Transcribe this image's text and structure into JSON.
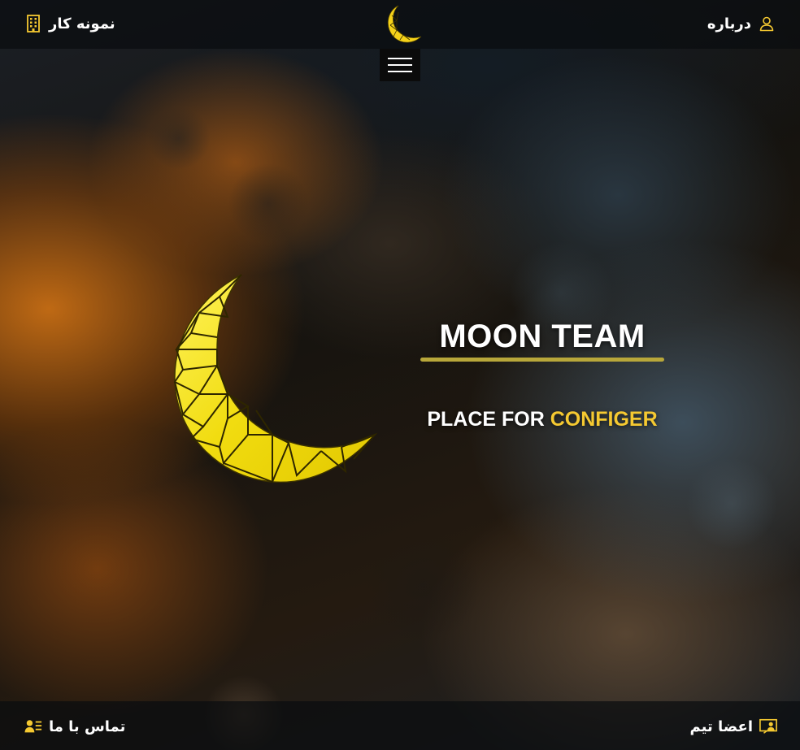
{
  "colors": {
    "accent": "#f5c931",
    "underline": "#b8a73a",
    "bar_background": "#0a0c0f",
    "text": "#ffffff"
  },
  "header": {
    "about": {
      "label": "درباره",
      "icon": "user-icon"
    },
    "portfolio": {
      "label": "نمونه کار",
      "icon": "building-icon"
    },
    "logo_icon": "crescent-moon-logo",
    "menu_icon": "hamburger-menu-icon"
  },
  "hero": {
    "title": "MOON TEAM",
    "subtitle_prefix": "PLACE FOR",
    "subtitle_highlight": "CONFIGER",
    "moon_icon": "crescent-moon-logo"
  },
  "footer": {
    "team": {
      "label": "اعضا تیم",
      "icon": "presentation-user-icon"
    },
    "contact": {
      "label": "تماس با ما",
      "icon": "contact-list-icon"
    }
  }
}
